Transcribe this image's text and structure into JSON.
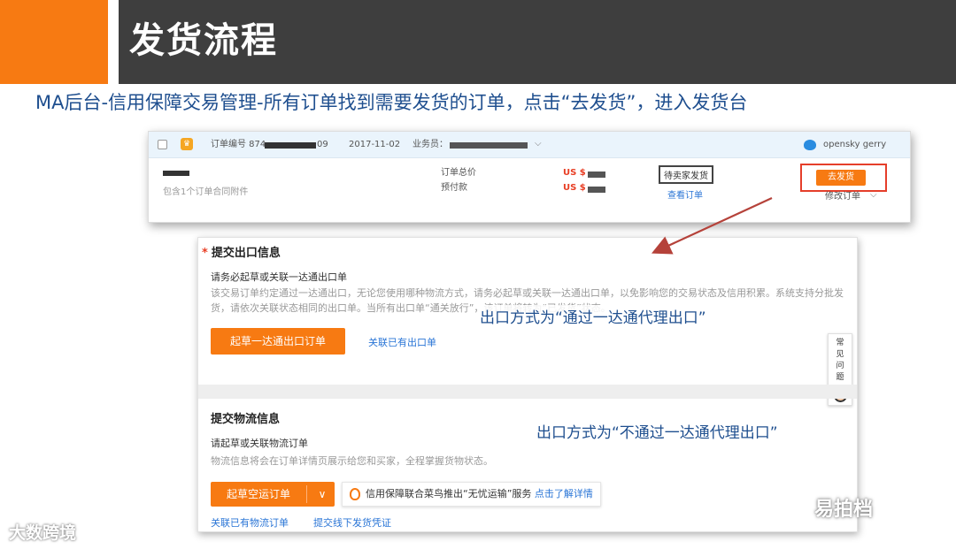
{
  "slide": {
    "title": "发货流程",
    "subtitle": "MA后台-信用保障交易管理-所有订单找到需要发货的订单，点击“去发货”，进入发货台"
  },
  "order": {
    "order_no_label": "订单编号 874",
    "order_no_suffix": "09",
    "date": "2017-11-02",
    "salesperson_label": "业务员：",
    "account_name": "opensky gerry",
    "attachment_text": "包含1个订单合同附件",
    "total_label": "订单总价",
    "prepay_label": "预付款",
    "currency_1": "US $",
    "currency_2": "US $",
    "status": "待卖家发货",
    "view_link": "查看订单",
    "ship_button": "去发货",
    "modify_link": "修改订单"
  },
  "export_section": {
    "required_mark": "*",
    "title": "提交出口信息",
    "requirement": "请务必起草或关联一达通出口单",
    "desc": "该交易订单约定通过一达通出口，无论您使用哪种物流方式，请务必起草或关联一达通出口单，以免影响您的交易状态及信用积累。系统支持分批发货，请依次关联状态相同的出口单。当所有出口单“通关放行”，该订单将转为“已发货”状态。",
    "draft_button": "起草一达通出口订单",
    "link_existing": "关联已有出口单",
    "annotation": "出口方式为“通过一达通代理出口”"
  },
  "faq": {
    "chars": [
      "常",
      "见",
      "问",
      "题"
    ]
  },
  "logistics_section": {
    "title": "提交物流信息",
    "requirement": "请起草或关联物流订单",
    "desc": "物流信息将会在订单详情页展示给您和买家，全程掌握货物状态。",
    "annotation": "出口方式为“不通过一达通代理出口”",
    "draft_button": "起草空运订单",
    "promo_text": "信用保障联合菜鸟推出“无忧运输”服务",
    "promo_link": "点击了解详情",
    "link_existing": "关联已有物流订单",
    "link_offline": "提交线下发货凭证"
  },
  "watermarks": {
    "left": "大数跨境",
    "right": "易拍档"
  },
  "colors": {
    "brand_orange": "#f77a12",
    "header_dark": "#3e3e3e",
    "subtitle_blue": "#1f4f8f",
    "link_blue": "#2a75d6",
    "price_red": "#e83e24",
    "arrow_red": "#b5423a"
  }
}
